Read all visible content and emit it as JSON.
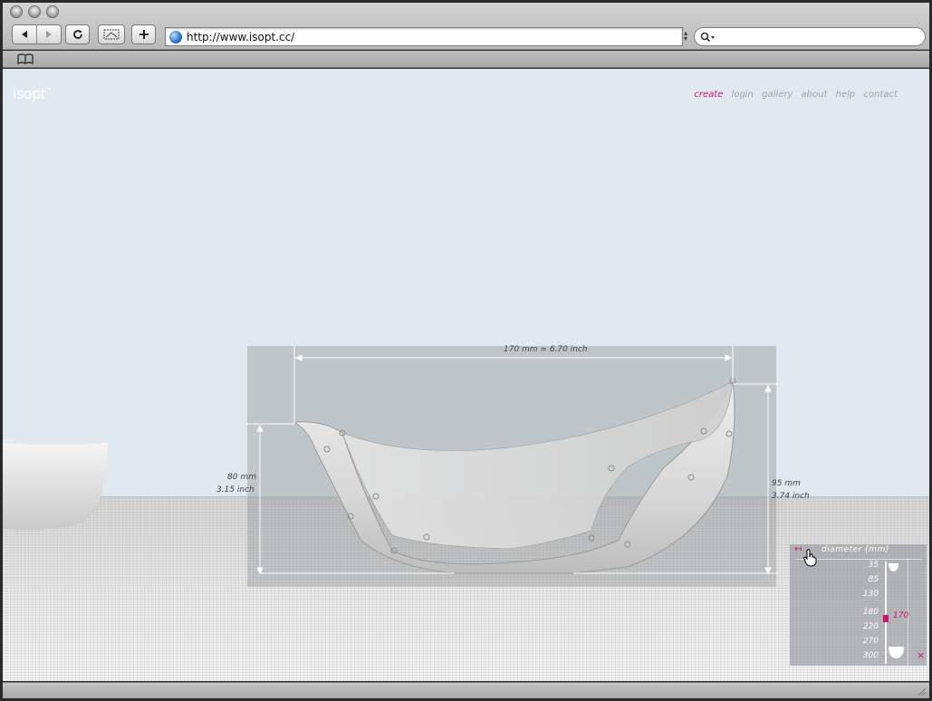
{
  "browser": {
    "url": "http://www.isopt.cc/",
    "search_placeholder": ""
  },
  "site": {
    "logo": "isopt",
    "logo_tm": "™",
    "nav": [
      {
        "label": "create",
        "active": true
      },
      {
        "label": "login",
        "active": false
      },
      {
        "label": "gallery",
        "active": false
      },
      {
        "label": "about",
        "active": false
      },
      {
        "label": "help",
        "active": false
      },
      {
        "label": "contact",
        "active": false
      }
    ]
  },
  "dimensions": {
    "width_label": "170 mm = 6.70 inch",
    "left_height_mm": "80 mm",
    "left_height_inch": "3.15 inch",
    "right_height_mm": "95 mm",
    "right_height_inch": "3.74 inch"
  },
  "diameter_panel": {
    "title": "diameter (mm)",
    "scale": [
      "35",
      "85",
      "130",
      "180",
      "220",
      "270",
      "300"
    ],
    "current_value": "170",
    "current_fraction": 0.5,
    "close_symbol": "×",
    "back_symbol": "↤"
  },
  "colors": {
    "accent": "#d01270",
    "page_bg": "#e0e9ef",
    "nav_inactive": "#9aa6ad"
  }
}
